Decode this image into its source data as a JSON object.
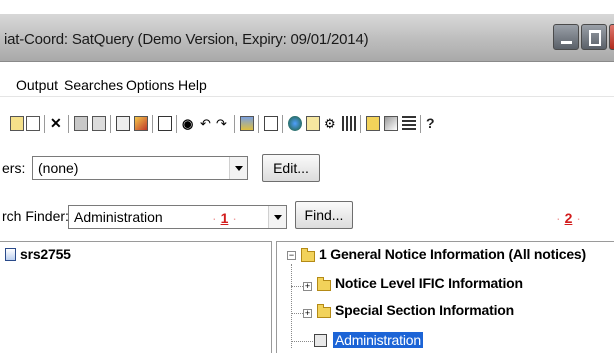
{
  "window": {
    "title": "iat-Coord: SatQuery (Demo Version, Expiry: 09/01/2014)"
  },
  "menu": {
    "items": [
      "Output",
      "Searches",
      "Options",
      "Help"
    ]
  },
  "toolbar": {
    "icons": [
      "new-icon",
      "open-icon",
      "cut-icon",
      "copy-icon",
      "paste-icon",
      "print-icon",
      "properties-icon",
      "edit-icon",
      "export-icon",
      "find-icon",
      "undo-icon",
      "redo-icon",
      "filter-icon",
      "settings-icon",
      "globe-icon",
      "book-icon",
      "tools-icon",
      "grid-icon",
      "refresh-icon",
      "options-icon",
      "list-icon",
      "help-icon"
    ]
  },
  "filters": {
    "label": "ers:",
    "value": "(none)",
    "edit_label": "Edit..."
  },
  "search_finder": {
    "label": "rch Finder:",
    "value": "Administration",
    "find_label": "Find...",
    "marker1": "1",
    "marker2": "2"
  },
  "left_pane": {
    "item": "srs2755"
  },
  "tree": {
    "root": "1 General Notice Information (All notices)",
    "children": [
      "Notice Level IFIC Information",
      "Special Section Information"
    ],
    "selected": "Administration"
  }
}
